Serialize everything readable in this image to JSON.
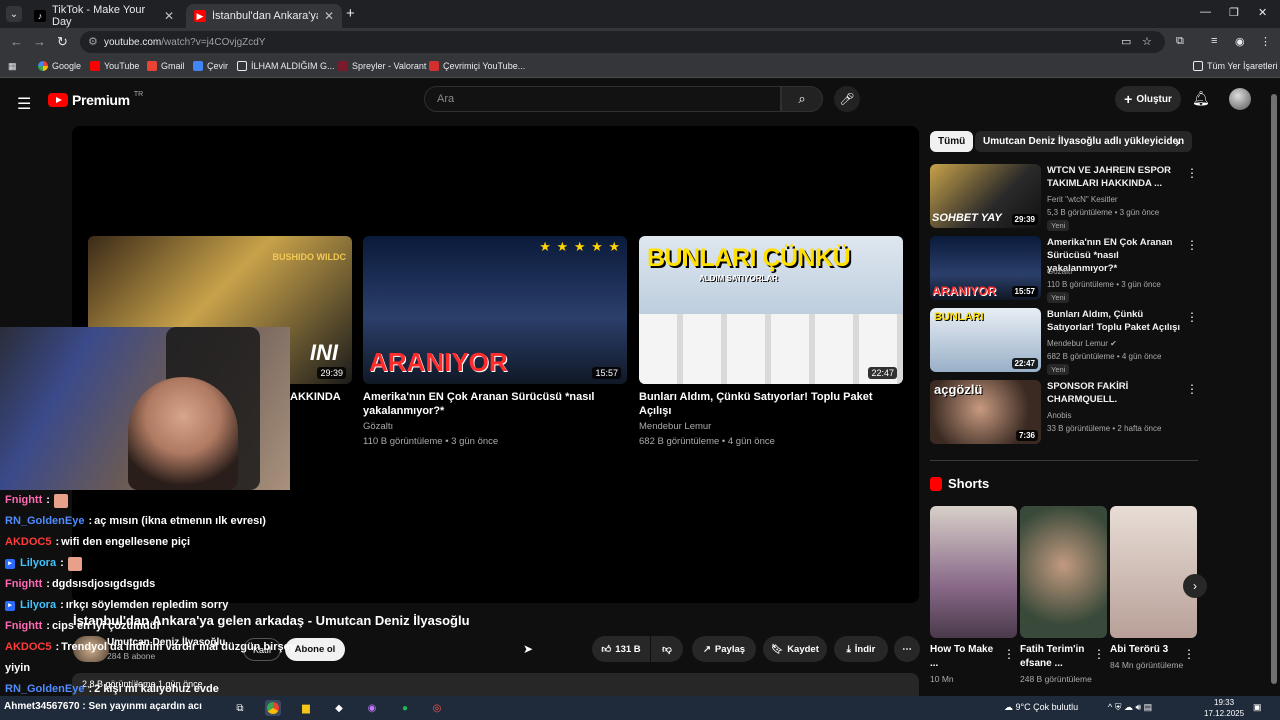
{
  "browser": {
    "tabs": [
      {
        "label": "TikTok - Make Your Day",
        "active": false
      },
      {
        "label": "İstanbul'dan Ankara'ya gelen ar",
        "active": true
      }
    ],
    "url_host": "youtube.com",
    "url_rest": "/watch?v=j4COvjgZcdY",
    "bookmarks": [
      "Google",
      "YouTube",
      "Gmail",
      "Çevir",
      "İLHAM ALDIĞIM G...",
      "Spreyler - Valorant",
      "Çevrimiçi YouTube..."
    ],
    "all_bookmarks": "Tüm Yer İşaretleri"
  },
  "youtube": {
    "logo_text": "Premium",
    "logo_region": "TR",
    "search_placeholder": "Ara",
    "create_label": "Oluştur",
    "end_cards": [
      {
        "title": "AKKINDA",
        "channel": "",
        "meta": "",
        "duration": "29:39",
        "thumb_right": "BUSHIDO WILDC",
        "thumb_big": "INI"
      },
      {
        "title": "Amerika'nın EN Çok Aranan Sürücüsü *nasıl yakalanmıyor?*",
        "channel": "Gözaltı",
        "meta": "110 B görüntüleme • 3 gün önce",
        "duration": "15:57",
        "thumb_big": "ARANIYOR",
        "stars": "★ ★ ★ ★ ★"
      },
      {
        "title": "Bunları Aldım, Çünkü Satıyorlar! Toplu Paket Açılışı",
        "channel": "Mendebur Lemur",
        "meta": "682 B görüntüleme • 4 gün önce",
        "duration": "22:47",
        "thumb_big": "BUNLARI ÇÜNKÜ",
        "thumb_sub": "ALDIM SATIYORLAR"
      }
    ],
    "video_title": "İstanbul'dan Ankara'ya gelen arkadaş - Umutcan Deniz İlyasoğlu",
    "channel_name": "Umutcan Deniz İlyasoğlu",
    "subscribers": "284 B abone",
    "join_label": "Katıl",
    "subscribe_label": "Abone ol",
    "likes": "131 B",
    "share_label": "Paylaş",
    "save_label": "Kaydet",
    "download_label": "İndir",
    "desc_line": "2,8 B görüntüleme  1 gün önce",
    "chips": [
      "Tümü",
      "Umutcan Deniz İlyasoğlu adlı yükleyiciden"
    ],
    "recommendations": [
      {
        "title": "WTCN VE JAHREIN ESPOR TAKIMLARI HAKKINDA ...",
        "channel": "Ferit \"wtcN\" Kesitler",
        "meta": "5,3 B görüntüleme • 3 gün önce",
        "badge": "Yeni",
        "duration": "29:39",
        "thumb_label": "SOHBET YAY"
      },
      {
        "title": "Amerika'nın EN Çok Aranan Sürücüsü *nasıl yakalanmıyor?*",
        "channel": "Gözaltı",
        "meta": "110 B görüntüleme • 3 gün önce",
        "badge": "Yeni",
        "duration": "15:57",
        "thumb_label": "ARANIYOR"
      },
      {
        "title": "Bunları Aldım, Çünkü Satıyorlar! Toplu Paket Açılışı",
        "channel": "Mendebur Lemur ✔",
        "meta": "682 B görüntüleme • 4 gün önce",
        "badge": "Yeni",
        "duration": "22:47",
        "thumb_label": "BUNLARI"
      },
      {
        "title": "SPONSOR FAKİRİ CHARMQUELL.",
        "channel": "Anobis",
        "meta": "33 B görüntüleme • 2 hafta önce",
        "badge": "",
        "duration": "7:36",
        "thumb_label": "açgözlü"
      }
    ],
    "shorts_title": "Shorts",
    "shorts": [
      {
        "title": "How To Make ...",
        "views": "10 Mn"
      },
      {
        "title": "Fatih Terim'in efsane ...",
        "views": "248 B görüntüleme"
      },
      {
        "title": "Abi Terörü 3",
        "views": "84 Mn görüntüleme"
      }
    ]
  },
  "stream_chat": [
    {
      "user": "Fnightt",
      "msg": "",
      "color": "#ff69b4",
      "emote": true,
      "badge": false
    },
    {
      "user": "RN_GoldenEye",
      "msg": "aç mısın (ikna etmenın ılk evresı)",
      "color": "#4f8cff",
      "emote": false,
      "badge": false
    },
    {
      "user": "AKDOC5",
      "msg": "wifi den engellesene piçi",
      "color": "#ff3b3b",
      "emote": false,
      "badge": false
    },
    {
      "user": "Lilyora",
      "msg": "",
      "color": "#40c4ff",
      "emote": true,
      "badge": true
    },
    {
      "user": "Fnightt",
      "msg": "dgdsısdjosıgdsgıds",
      "color": "#ff69b4",
      "emote": false,
      "badge": false
    },
    {
      "user": "Lilyora",
      "msg": "ırkçı söylemden repledim sorry",
      "color": "#40c4ff",
      "emote": false,
      "badge": true
    },
    {
      "user": "Fnightt",
      "msg": "cips en iyi çözümdür",
      "color": "#ff69b4",
      "emote": false,
      "badge": false
    },
    {
      "user": "AKDOC5",
      "msg": "Trendyol da indirim vardır mal düzgün birşey",
      "color": "#ff3b3b",
      "emote": false,
      "badge": false
    },
    {
      "user": "",
      "msg": "yiyin",
      "color": "#ffffff",
      "emote": false,
      "badge": false
    },
    {
      "user": "RN_GoldenEye",
      "msg": "2 kişi mi kalıyohuz evde",
      "color": "#4f8cff",
      "emote": false,
      "badge": false
    },
    {
      "user": "Ahmet34567670",
      "msg": "Sen yayınmı açardın acı",
      "color": "#ffffff",
      "emote": false,
      "badge": false
    }
  ],
  "taskbar": {
    "weather": "9°C  Çok bulutlu",
    "time": "19:33",
    "date": "17.12.2025"
  },
  "colors": {
    "yt_red": "#ff0000",
    "bg": "#0f0f0f",
    "chip_bg": "#272727"
  }
}
